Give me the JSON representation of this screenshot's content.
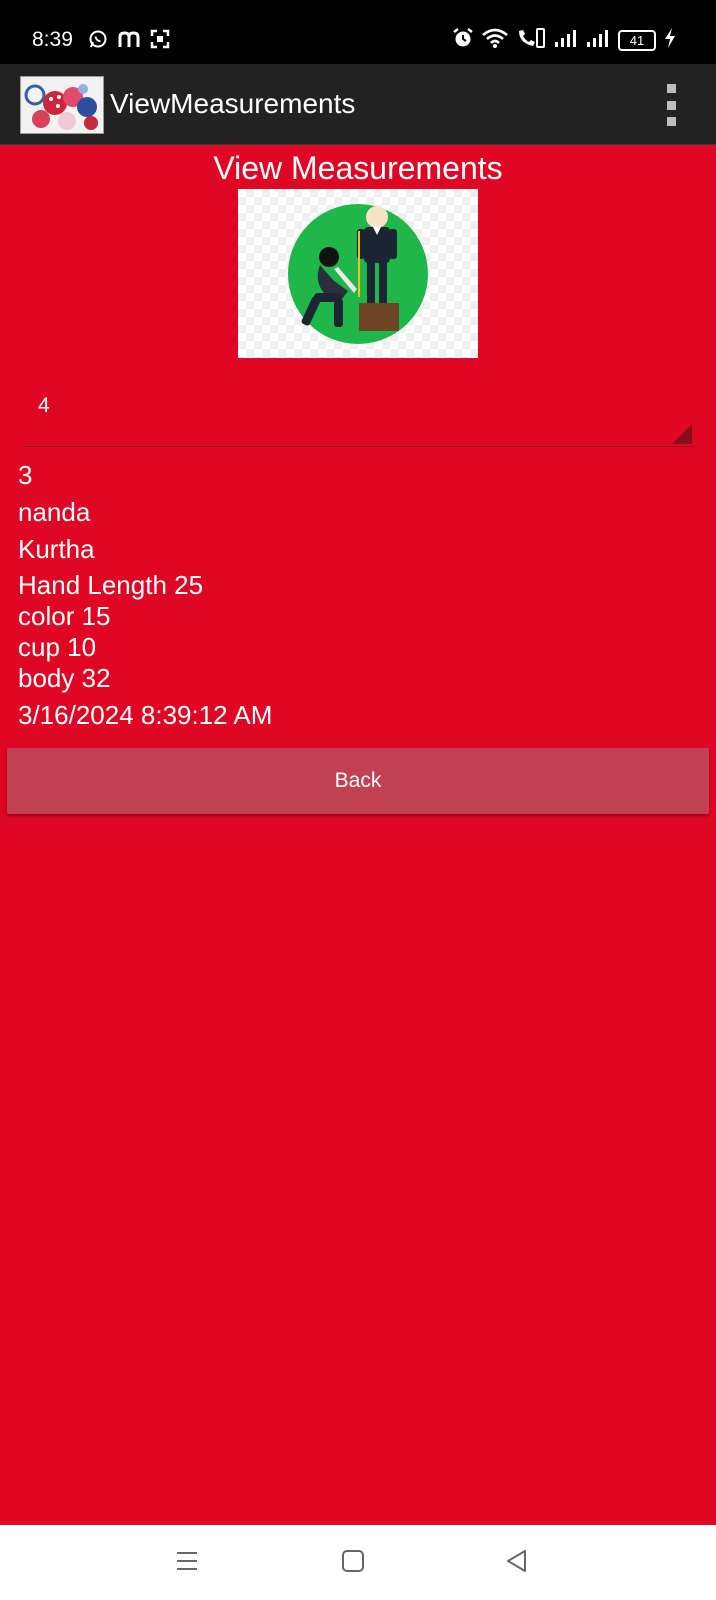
{
  "status_bar": {
    "time": "8:39",
    "left_icons": [
      "whatsapp-icon",
      "m-app-icon",
      "screenshot-icon"
    ],
    "right_icons": [
      "alarm-icon",
      "wifi-icon",
      "volte-call-icon",
      "signal-icon",
      "signal-icon"
    ],
    "battery": "41"
  },
  "app_bar": {
    "title": "ViewMeasurements",
    "logo": "fabric-thumbnail",
    "menu_icon": "overflow-menu-icon"
  },
  "page": {
    "heading": "View Measurements",
    "image": "tailor-measuring-illustration"
  },
  "spinner": {
    "selected": "4"
  },
  "details": {
    "id": "3",
    "name": "nanda",
    "garment": "Kurtha",
    "hand_length": "Hand Length 25",
    "color": "color 15",
    "cup": "cup 10",
    "body": "body 32",
    "timestamp": "3/16/2024 8:39:12 AM"
  },
  "back_button": {
    "label": "Back"
  },
  "colors": {
    "background": "#e00725",
    "app_bar": "#222222",
    "button": "#c14052"
  },
  "nav_bar": {
    "items": [
      "recents-icon",
      "home-icon",
      "back-icon"
    ]
  }
}
